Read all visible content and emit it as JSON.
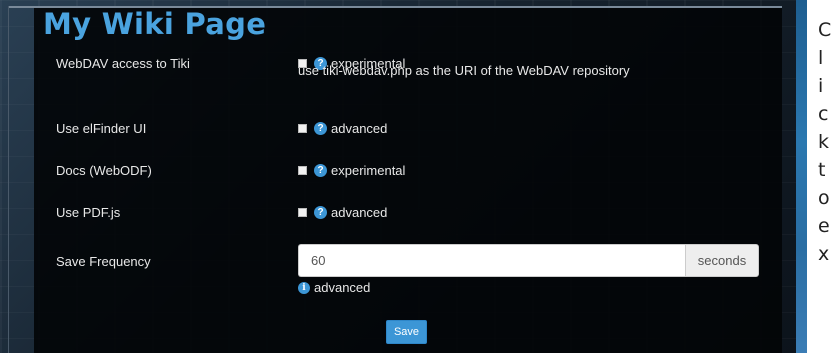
{
  "page": {
    "title": "My Wiki Page"
  },
  "rows": [
    {
      "label": "WebDAV access to Tiki",
      "option": "experimental",
      "hint": "use tiki-webdav.php as the URI of the WebDAV repository"
    },
    {
      "label": "Use elFinder UI",
      "option": "advanced"
    },
    {
      "label": "Docs (WebODF)",
      "option": "experimental"
    },
    {
      "label": "Use PDF.js",
      "option": "advanced"
    }
  ],
  "save_frequency": {
    "label": "Save Frequency",
    "value": "60",
    "unit": "seconds",
    "info": "advanced"
  },
  "save_label": "Save",
  "side_text": [
    "C",
    "l",
    "i",
    "c",
    "k",
    "t",
    "o",
    "e",
    "x"
  ],
  "colors": {
    "accent": "#3c96d6",
    "title": "#4aa3df",
    "panel": "#020407"
  },
  "icons": {
    "help": "question-circle",
    "info": "info-circle"
  }
}
